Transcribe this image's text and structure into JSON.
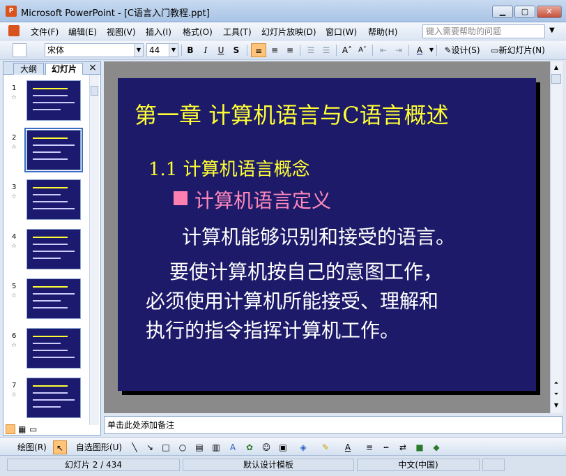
{
  "window": {
    "title": "Microsoft PowerPoint - [C语言入门教程.ppt]",
    "app_icon": "P"
  },
  "menu": [
    "文件(F)",
    "编辑(E)",
    "视图(V)",
    "插入(I)",
    "格式(O)",
    "工具(T)",
    "幻灯片放映(D)",
    "窗口(W)",
    "帮助(H)"
  ],
  "help_placeholder": "键入需要帮助的问题",
  "toolbar": {
    "font": "宋体",
    "size": "44",
    "bold": "B",
    "italic": "I",
    "underline": "U",
    "shadow": "S",
    "design": "设计(S)",
    "new_slide": "新幻灯片(N)"
  },
  "panel": {
    "tab_outline": "大纲",
    "tab_slides": "幻灯片",
    "close": "×"
  },
  "thumbnails": [
    {
      "num": "1"
    },
    {
      "num": "2",
      "selected": true
    },
    {
      "num": "3"
    },
    {
      "num": "4"
    },
    {
      "num": "5"
    },
    {
      "num": "6"
    },
    {
      "num": "7"
    }
  ],
  "slide": {
    "title": "第一章   计算机语言与C语言概述",
    "subtitle": "1.1 计算机语言概念",
    "definition": "计算机语言定义",
    "line1": "计算机能够识别和接受的语言。",
    "line2": "要使计算机按自己的意图工作，",
    "line3": "必须使用计算机所能接受、理解和",
    "line4": "执行的指令指挥计算机工作。"
  },
  "notes_placeholder": "单击此处添加备注",
  "drawbar": {
    "draw": "绘图(R)",
    "autoshape": "自选图形(U)"
  },
  "status": {
    "slide": "幻灯片 2 / 434",
    "template": "默认设计模板",
    "language": "中文(中国)"
  },
  "colors": {
    "slide_bg": "#1d1a6a",
    "title_yellow": "#ffff33",
    "accent_pink": "#ff88bb"
  }
}
